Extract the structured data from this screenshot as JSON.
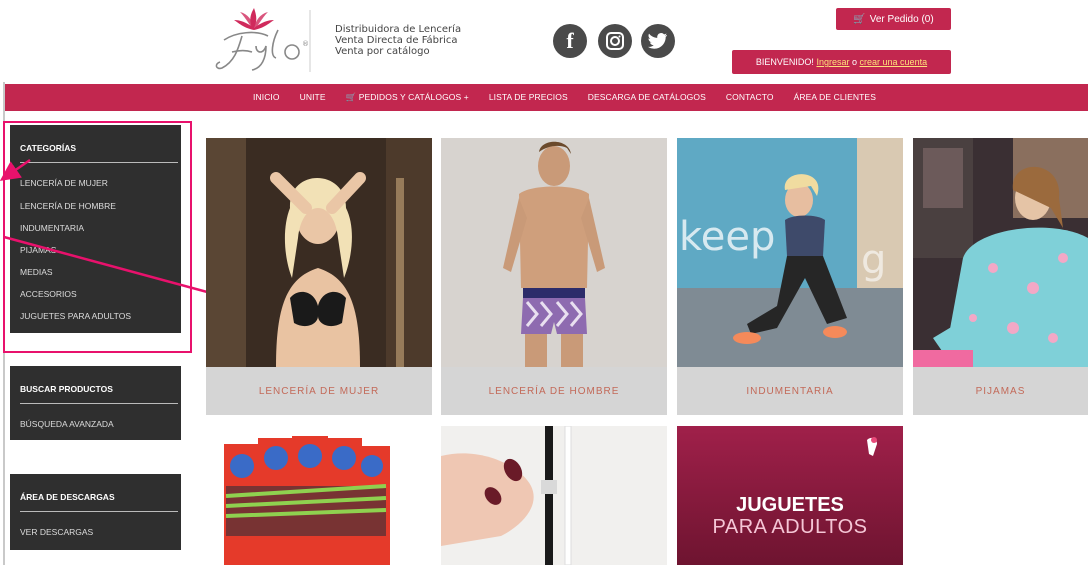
{
  "header": {
    "logo_text": "Fylo",
    "tagline": [
      "Distribuidora de Lencería",
      "Venta Directa de Fábrica",
      "Venta por catálogo"
    ],
    "social": [
      "facebook-icon",
      "instagram-icon",
      "twitter-icon"
    ],
    "order_button": "Ver Pedido (0)",
    "welcome": {
      "prefix": "BIENVENIDO!",
      "login": "Ingresar",
      "or": "o",
      "register": "crear una cuenta"
    }
  },
  "nav": {
    "items": [
      "INICIO",
      "UNITE",
      "PEDIDOS Y CATÁLOGOS",
      "LISTA DE PRECIOS",
      "DESCARGA DE CATÁLOGOS",
      "CONTACTO",
      "ÁREA DE CLIENTES"
    ]
  },
  "sidebar": {
    "categories_title": "CATEGORÍAS",
    "categories": [
      "LENCERÍA DE MUJER",
      "LENCERÍA DE HOMBRE",
      "INDUMENTARIA",
      "PIJAMAS",
      "MEDIAS",
      "ACCESORIOS",
      "JUGUETES PARA ADULTOS"
    ],
    "search_title": "BUSCAR PRODUCTOS",
    "search_link": "BÚSQUEDA AVANZADA",
    "downloads_title": "ÁREA DE DESCARGAS",
    "downloads_link": "VER DESCARGAS"
  },
  "tiles": {
    "row1": [
      "LENCERÍA DE MUJER",
      "LENCERÍA DE HOMBRE",
      "INDUMENTARIA",
      "PIJAMAS"
    ],
    "banner": {
      "line1": "JUGUETES",
      "line2": "PARA ADULTOS",
      "bg_text": "keep"
    }
  },
  "colors": {
    "brand": "#c2274f",
    "sidebar": "#2f2f2f",
    "annotation": "#e8116c",
    "caption": "#c36a59"
  }
}
